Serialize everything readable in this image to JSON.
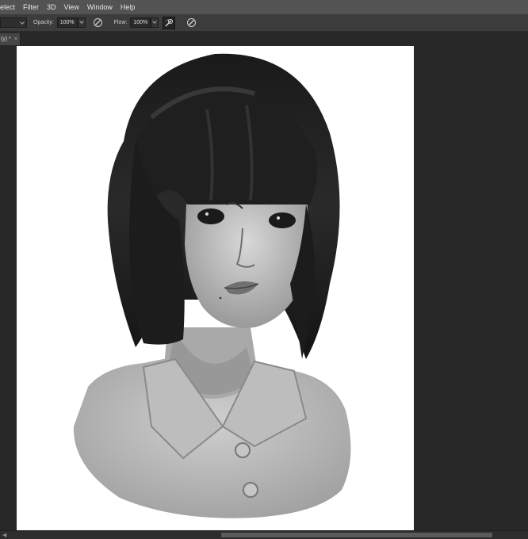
{
  "menubar": {
    "items": [
      "elect",
      "Filter",
      "3D",
      "View",
      "Window",
      "Help"
    ]
  },
  "options": {
    "opacity_label": "Opacity:",
    "opacity_value": "100%",
    "flow_label": "Flow:",
    "flow_value": "100%"
  },
  "tab": {
    "label": "(y) *",
    "close": "×"
  },
  "icons": {
    "pressure_opacity": "stylus-pressure-opacity-icon",
    "airbrush": "airbrush-icon",
    "pressure_size": "stylus-pressure-size-icon"
  },
  "canvas": {
    "content": "grayscale digital painting of a woman with a black bob haircut and a collared shirt"
  },
  "colors": {
    "menubar": "#535353",
    "options_bar": "#3c3c3c",
    "workspace": "#282828",
    "canvas": "#ffffff"
  }
}
